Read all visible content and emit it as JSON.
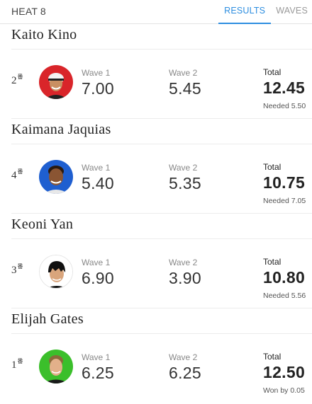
{
  "header": {
    "heat_title": "HEAT 8",
    "tabs": [
      {
        "label": "RESULTS",
        "active": true
      },
      {
        "label": "WAVES",
        "active": false
      }
    ]
  },
  "colors": {
    "accent": "#2d8ee0",
    "avatar_bg": [
      "#d9252a",
      "#1f5fd0",
      "#ffffff",
      "#3bbf2b"
    ]
  },
  "surfers": [
    {
      "name": "Kaito Kino",
      "seed": "2",
      "seed_suffix": "番",
      "wave1_label": "Wave 1",
      "wave1": "7.00",
      "wave2_label": "Wave 2",
      "wave2": "5.45",
      "total_label": "Total",
      "total": "12.45",
      "status_label": "Needed",
      "status_value": "5.50"
    },
    {
      "name": "Kaimana Jaquias",
      "seed": "4",
      "seed_suffix": "番",
      "wave1_label": "Wave 1",
      "wave1": "5.40",
      "wave2_label": "Wave 2",
      "wave2": "5.35",
      "total_label": "Total",
      "total": "10.75",
      "status_label": "Needed",
      "status_value": "7.05"
    },
    {
      "name": "Keoni Yan",
      "seed": "3",
      "seed_suffix": "番",
      "wave1_label": "Wave 1",
      "wave1": "6.90",
      "wave2_label": "Wave 2",
      "wave2": "3.90",
      "total_label": "Total",
      "total": "10.80",
      "status_label": "Needed",
      "status_value": "5.56"
    },
    {
      "name": "Elijah Gates",
      "seed": "1",
      "seed_suffix": "番",
      "wave1_label": "Wave 1",
      "wave1": "6.25",
      "wave2_label": "Wave 2",
      "wave2": "6.25",
      "total_label": "Total",
      "total": "12.50",
      "status_label": "Won by",
      "status_value": "0.05"
    }
  ]
}
